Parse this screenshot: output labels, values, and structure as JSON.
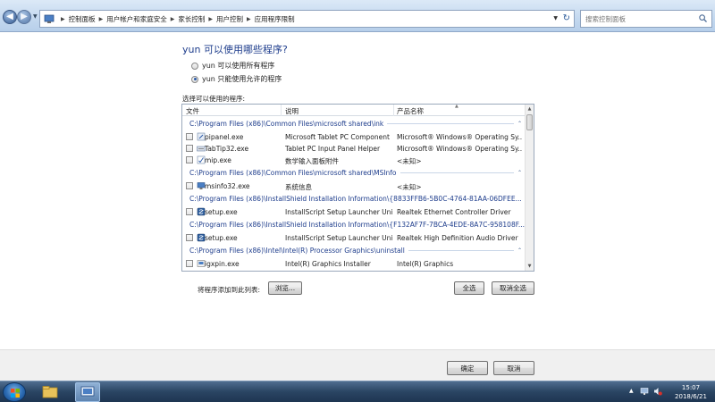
{
  "window": {
    "breadcrumb": [
      "控制面板",
      "用户帐户和家庭安全",
      "家长控制",
      "用户控制",
      "应用程序限制"
    ],
    "search_placeholder": "搜索控制面板"
  },
  "main": {
    "title": "yun 可以使用哪些程序?",
    "radio_all_label": "yun 可以使用所有程序",
    "radio_allowed_label": "yun 只能使用允许的程序",
    "list_label": "选择可以使用的程序:",
    "columns": [
      "文件",
      "说明",
      "产品名称"
    ],
    "groups": [
      {
        "path": "C:\\Program Files (x86)\\Common Files\\microsoft shared\\ink",
        "rows": [
          {
            "file": "pipanel.exe",
            "desc": "Microsoft Tablet PC Component",
            "product": "Microsoft® Windows® Operating Sy..."
          },
          {
            "file": "TabTip32.exe",
            "desc": "Tablet PC Input Panel Helper",
            "product": "Microsoft® Windows® Operating Sy..."
          },
          {
            "file": "mip.exe",
            "desc": "数学输入面板附件",
            "product": "<未知>"
          }
        ]
      },
      {
        "path": "C:\\Program Files (x86)\\Common Files\\microsoft shared\\MSInfo",
        "rows": [
          {
            "file": "msinfo32.exe",
            "desc": "系统信息",
            "product": "<未知>"
          }
        ]
      },
      {
        "path": "C:\\Program Files (x86)\\InstallShield Installation Information\\{8833FFB6-5B0C-4764-81AA-06DFEE...",
        "rows": [
          {
            "file": "setup.exe",
            "desc": "InstallScript Setup Launcher Unic...",
            "product": "Realtek Ethernet Controller Driver"
          }
        ]
      },
      {
        "path": "C:\\Program Files (x86)\\InstallShield Installation Information\\{F132AF7F-7BCA-4EDE-8A7C-958108F...",
        "rows": [
          {
            "file": "setup.exe",
            "desc": "InstallScript Setup Launcher Unic...",
            "product": "Realtek High Definition Audio Driver"
          }
        ]
      },
      {
        "path": "C:\\Program Files (x86)\\Intel\\Intel(R) Processor Graphics\\uninstall",
        "rows": [
          {
            "file": "igxpin.exe",
            "desc": "Intel(R) Graphics Installer",
            "product": "Intel(R) Graphics"
          }
        ]
      }
    ],
    "add_label": "将程序添加到此列表:",
    "browse_label": "浏览...",
    "select_all_label": "全选",
    "clear_all_label": "取消全选"
  },
  "footer": {
    "ok_label": "确定",
    "cancel_label": "取消"
  },
  "taskbar": {
    "time": "15:07",
    "date": "2018/6/21"
  },
  "colors": {
    "accent": "#1e3d8c",
    "taskbar": "#2a4563"
  }
}
